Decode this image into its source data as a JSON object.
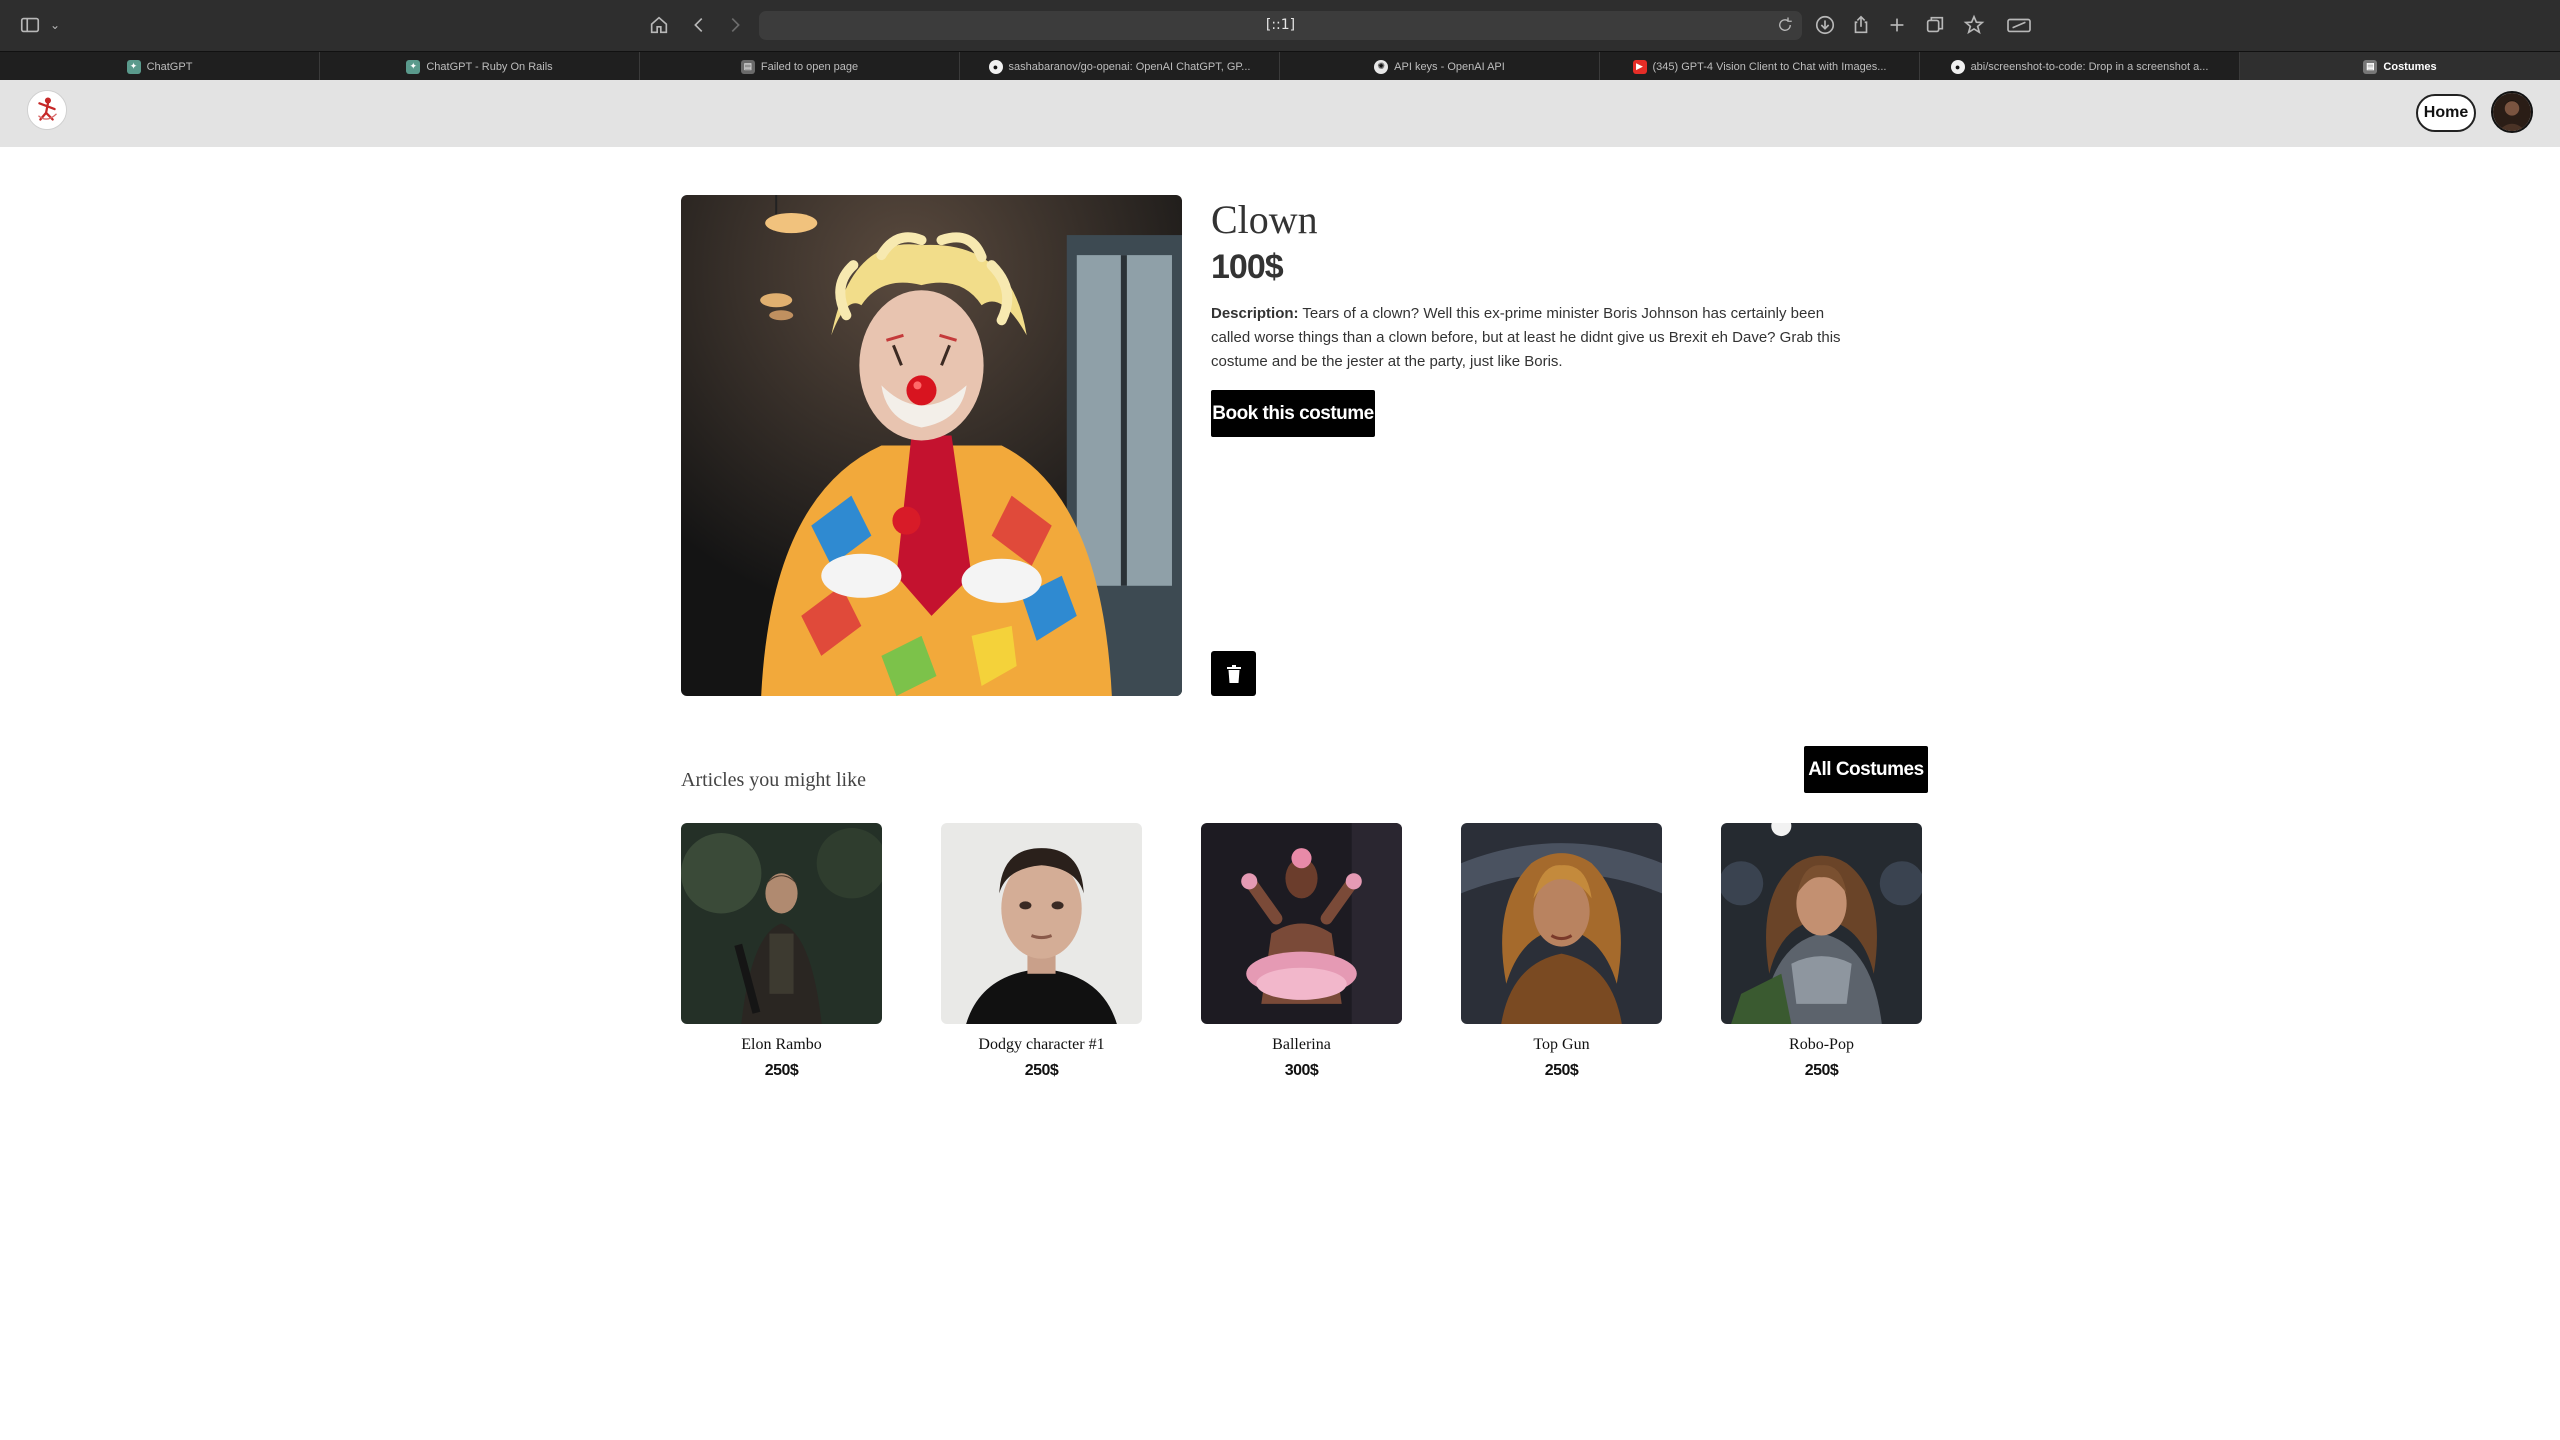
{
  "browser": {
    "address": "[::1]",
    "tabs": [
      {
        "label": "ChatGPT",
        "icon": "chatgpt-favicon"
      },
      {
        "label": "ChatGPT - Ruby On Rails",
        "icon": "chatgpt-favicon"
      },
      {
        "label": "Failed to open page",
        "icon": "page-favicon"
      },
      {
        "label": "sashabaranov/go-openai: OpenAI ChatGPT, GP...",
        "icon": "github-favicon"
      },
      {
        "label": "API keys - OpenAI API",
        "icon": "openai-favicon"
      },
      {
        "label": "(345) GPT-4 Vision Client to Chat with Images...",
        "icon": "youtube-favicon"
      },
      {
        "label": "abi/screenshot-to-code: Drop in a screenshot a...",
        "icon": "github-favicon"
      },
      {
        "label": "Costumes",
        "icon": "costumes-favicon",
        "active": true
      }
    ]
  },
  "header": {
    "home_label": "Home"
  },
  "product": {
    "title": "Clown",
    "price": "100$",
    "description_label": "Description:",
    "description": "Tears of a clown? Well this ex-prime minister Boris Johnson has certainly been called worse things than a clown before, but at least he didnt give us Brexit eh Dave? Grab this costume and be the jester at the party, just like Boris.",
    "book_label": "Book this costume"
  },
  "related": {
    "heading": "Articles you might like",
    "all_label": "All Costumes",
    "items": [
      {
        "name": "Elon Rambo",
        "price": "250$"
      },
      {
        "name": "Dodgy character #1",
        "price": "250$"
      },
      {
        "name": "Ballerina",
        "price": "300$"
      },
      {
        "name": "Top Gun",
        "price": "250$"
      },
      {
        "name": "Robo-Pop",
        "price": "250$"
      }
    ]
  },
  "colors": {
    "toolbar": "#2e2e2e",
    "tabbar": "#1f1f1f",
    "header": "#e3e3e3",
    "button": "#000000"
  }
}
